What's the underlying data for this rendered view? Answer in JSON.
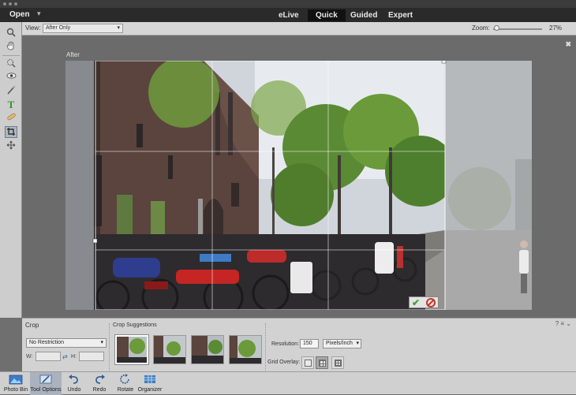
{
  "menubar": {
    "open_label": "Open",
    "open_arrow": "▾",
    "modes": [
      {
        "label": "eLive",
        "active": false
      },
      {
        "label": "Quick",
        "active": true
      },
      {
        "label": "Guided",
        "active": false
      },
      {
        "label": "Expert",
        "active": false
      }
    ]
  },
  "options_bar": {
    "view_label": "View:",
    "view_value": "After Only",
    "zoom_label": "Zoom:",
    "zoom_value": "27%",
    "zoom_level": 0.27
  },
  "tools": [
    {
      "name": "zoom-tool",
      "icon": "magnifier-icon",
      "glyph": "🔍"
    },
    {
      "name": "hand-tool",
      "icon": "hand-icon",
      "glyph": "✋"
    },
    {
      "name": "quick-selection-tool",
      "icon": "quick-selection-icon",
      "glyph": "◌"
    },
    {
      "name": "red-eye-tool",
      "icon": "eye-icon",
      "glyph": "◉"
    },
    {
      "name": "whiten-teeth-tool",
      "icon": "brush-icon",
      "glyph": "╱"
    },
    {
      "name": "type-tool",
      "icon": "type-icon",
      "glyph": "T"
    },
    {
      "name": "spot-healing-tool",
      "icon": "bandage-icon",
      "glyph": "✎"
    },
    {
      "name": "crop-tool",
      "icon": "crop-icon",
      "glyph": "⛶"
    },
    {
      "name": "move-tool",
      "icon": "move-icon",
      "glyph": "✥"
    }
  ],
  "canvas": {
    "after_label": "After",
    "close_glyph": "✖"
  },
  "confirm": {
    "ok_glyph": "✔"
  },
  "crop_panel": {
    "title": "Crop",
    "restriction_value": "No Restriction",
    "width_label": "W:",
    "height_label": "H:",
    "width_value": "",
    "height_value": "",
    "suggestions_title": "Crop Suggestions",
    "resolution_label": "Resolution:",
    "resolution_value": "150",
    "resolution_unit": "Pixels/Inch",
    "grid_overlay_label": "Grid Overlay:",
    "grid_overlay_options": [
      "none",
      "rule-of-thirds",
      "grid"
    ],
    "grid_overlay_selected": "rule-of-thirds"
  },
  "bottom_bar": [
    {
      "label": "Photo Bin",
      "icon": "photo-bin-icon",
      "active": false
    },
    {
      "label": "Tool Options",
      "icon": "tool-options-icon",
      "active": true
    },
    {
      "label": "Undo",
      "icon": "undo-icon",
      "active": false
    },
    {
      "label": "Redo",
      "icon": "redo-icon",
      "active": false
    },
    {
      "label": "Rotate",
      "icon": "rotate-icon",
      "active": false
    },
    {
      "label": "Organizer",
      "icon": "organizer-icon",
      "active": false
    }
  ],
  "colors": {
    "menubar_bg": "#2a2a2a",
    "active_tab_bg": "#111111",
    "panel_bg": "#d2d2d2",
    "confirm_green": "#3ea33a",
    "cancel_red": "#c0382b",
    "accent_blue": "#3a64a5"
  }
}
